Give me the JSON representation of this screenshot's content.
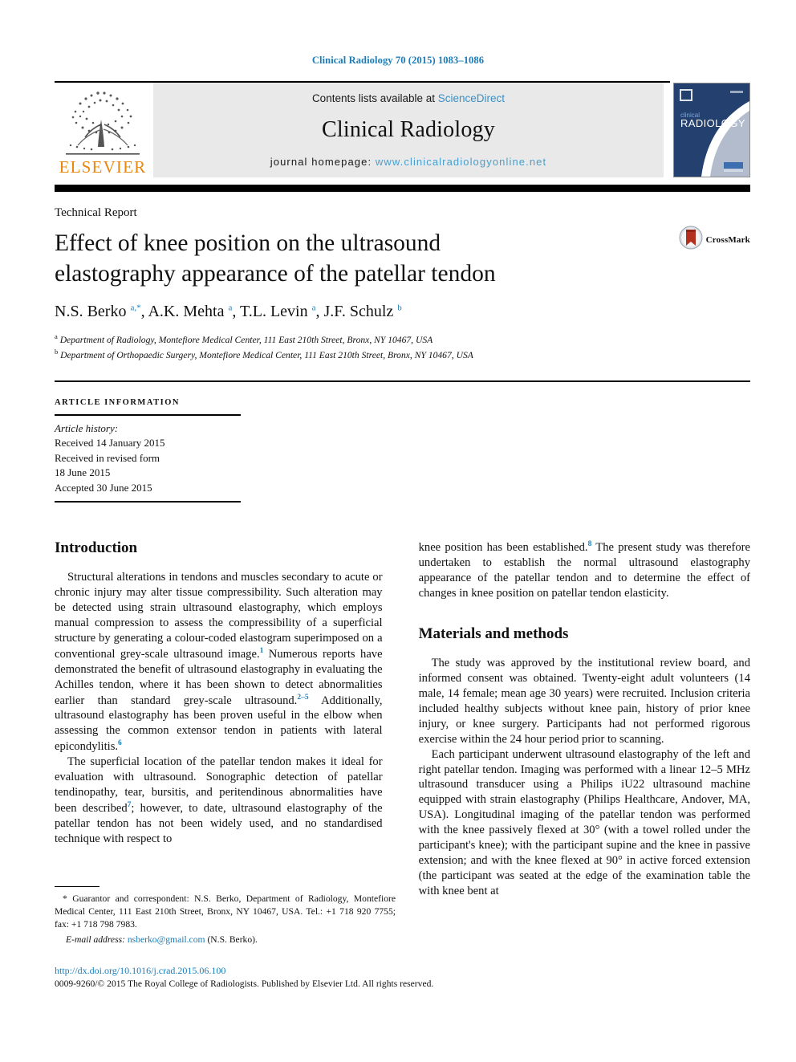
{
  "running_head": "Clinical Radiology 70 (2015) 1083–1086",
  "masthead": {
    "publisher_logo_label": "ELSEVIER",
    "contents_prefix": "Contents lists available at ",
    "contents_link": "ScienceDirect",
    "journal_name": "Clinical Radiology",
    "homepage_prefix": "journal homepage: ",
    "homepage_url": "www.clinicalradiologyonline.net",
    "cover_title_line1": "clinical",
    "cover_title_line2": "RADIOLOGY",
    "colors": {
      "elsevier_orange": "#e8860d",
      "link_blue": "#3a8fc4",
      "running_head_blue": "#1a7cb8",
      "contents_band_grey": "#e9e9e9",
      "cover_navy": "#1f3c72"
    }
  },
  "article": {
    "doctype": "Technical Report",
    "title": "Effect of knee position on the ultrasound elastography appearance of the patellar tendon",
    "authors_html": "N.S. Berko <sup>a,*</sup>, A.K. Mehta <sup>a</sup>, T.L. Levin <sup>a</sup>, J.F. Schulz <sup>b</sup>",
    "affiliation_a": "Department of Radiology, Montefiore Medical Center, 111 East 210th Street, Bronx, NY 10467, USA",
    "affiliation_b": "Department of Orthopaedic Surgery, Montefiore Medical Center, 111 East 210th Street, Bronx, NY 10467, USA",
    "crossmark_label": "CrossMark"
  },
  "article_info": {
    "heading": "ARTICLE INFORMATION",
    "history_label": "Article history:",
    "received": "Received 14 January 2015",
    "revised_label": "Received in revised form",
    "revised_date": "18 June 2015",
    "accepted": "Accepted 30 June 2015"
  },
  "body": {
    "introduction_heading": "Introduction",
    "intro_p1_html": "Structural alterations in tendons and muscles secondary to acute or chronic injury may alter tissue compressibility. Such alteration may be detected using strain ultrasound elastography, which employs manual compression to assess the compressibility of a superficial structure by generating a colour-coded elastogram superimposed on a conventional grey-scale ultrasound image.<sup>1</sup> Numerous reports have demonstrated the benefit of ultrasound elastography in evaluating the Achilles tendon, where it has been shown to detect abnormalities earlier than standard grey-scale ultrasound.<sup>2–5</sup> Additionally, ultrasound elastography has been proven useful in the elbow when assessing the common extensor tendon in patients with lateral epicondylitis.<sup>6</sup>",
    "intro_p2_html": "The superficial location of the patellar tendon makes it ideal for evaluation with ultrasound. Sonographic detection of patellar tendinopathy, tear, bursitis, and peritendinous abnormalities have been described<sup>7</sup>; however, to date, ultrasound elastography of the patellar tendon has not been widely used, and no standardised technique with respect to",
    "intro_p2_cont_html": "knee position has been established.<sup>8</sup> The present study was therefore undertaken to establish the normal ultrasound elastography appearance of the patellar tendon and to determine the effect of changes in knee position on patellar tendon elasticity.",
    "materials_heading": "Materials and methods",
    "materials_p1_html": "The study was approved by the institutional review board, and informed consent was obtained. Twenty-eight adult volunteers (14 male, 14 female; mean age 30 years) were recruited. Inclusion criteria included healthy subjects without knee pain, history of prior knee injury, or knee surgery. Participants had not performed rigorous exercise within the 24 hour period prior to scanning.",
    "materials_p2_html": "Each participant underwent ultrasound elastography of the left and right patellar tendon. Imaging was performed with a linear 12–5 MHz ultrasound transducer using a Philips iU22 ultrasound machine equipped with strain elastography (Philips Healthcare, Andover, MA, USA). Longitudinal imaging of the patellar tendon was performed with the knee passively flexed at 30° (with a towel rolled under the participant's knee); with the participant supine and the knee in passive extension; and with the knee flexed at 90° in active forced extension (the participant was seated at the edge of the examination table the with knee bent at"
  },
  "footnote": {
    "correspondence_html": "* Guarantor and correspondent: N.S. Berko, Department of Radiology, Montefiore Medical Center, 111 East 210th Street, Bronx, NY 10467, USA. Tel.: +1 718 920 7755; fax: +1 718 798 7983.",
    "email_label": "E-mail address:",
    "email_address": "nsberko@gmail.com",
    "email_suffix": "(N.S. Berko)."
  },
  "imprint": {
    "doi": "http://dx.doi.org/10.1016/j.crad.2015.06.100",
    "copyright": "0009-9260/© 2015 The Royal College of Radiologists. Published by Elsevier Ltd. All rights reserved."
  }
}
